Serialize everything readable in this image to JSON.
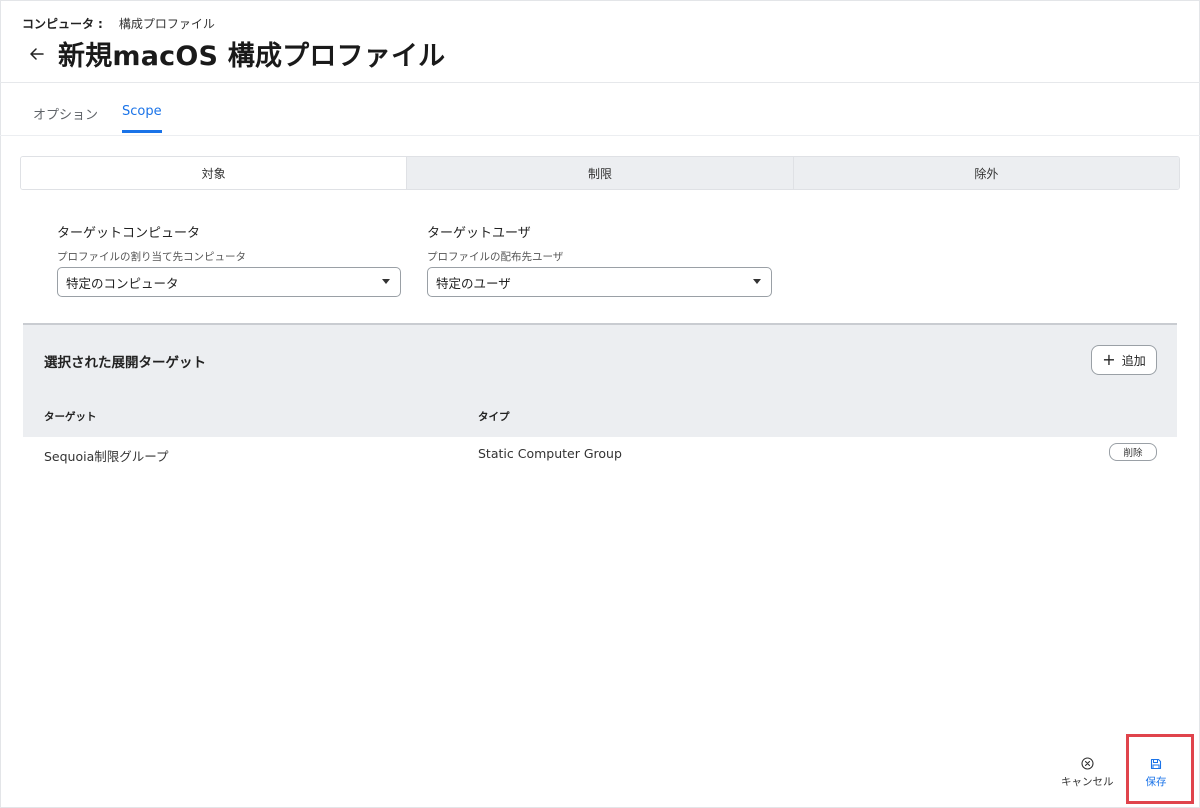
{
  "breadcrumb": {
    "root": "コンピュータ",
    "separator": ":",
    "leaf": "構成プロファイル"
  },
  "page": {
    "title": "新規macOS 構成プロファイル"
  },
  "tabs": [
    {
      "label": "オプション",
      "active": false
    },
    {
      "label": "Scope",
      "active": true
    }
  ],
  "segments": [
    {
      "label": "対象",
      "active": true
    },
    {
      "label": "制限",
      "active": false
    },
    {
      "label": "除外",
      "active": false
    }
  ],
  "target_computer": {
    "label": "ターゲットコンピュータ",
    "sublabel": "プロファイルの割り当て先コンピュータ",
    "value": "特定のコンピュータ"
  },
  "target_user": {
    "label": "ターゲットユーザ",
    "sublabel": "プロファイルの配布先ユーザ",
    "value": "特定のユーザ"
  },
  "targets_panel": {
    "title": "選択された展開ターゲット",
    "add_label": "追加",
    "columns": [
      "ターゲット",
      "タイプ"
    ],
    "rows": [
      {
        "target": "Sequoia制限グループ",
        "type": "Static Computer Group",
        "action": "削除"
      }
    ]
  },
  "footer": {
    "cancel_label": "キャンセル",
    "save_label": "保存"
  },
  "colors": {
    "accent": "#1a73e8",
    "highlight": "#e0444c"
  }
}
